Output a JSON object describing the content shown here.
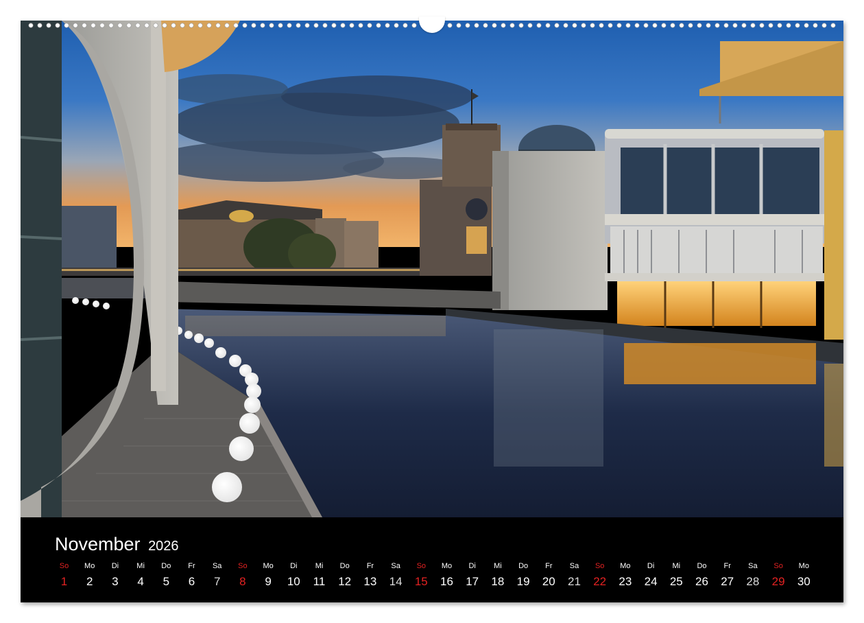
{
  "calendar": {
    "month": "November",
    "year": "2026",
    "days": [
      {
        "abbr": "So",
        "num": "1",
        "sunday": true
      },
      {
        "abbr": "Mo",
        "num": "2"
      },
      {
        "abbr": "Di",
        "num": "3"
      },
      {
        "abbr": "Mi",
        "num": "4"
      },
      {
        "abbr": "Do",
        "num": "5"
      },
      {
        "abbr": "Fr",
        "num": "6"
      },
      {
        "abbr": "Sa",
        "num": "7",
        "saturday": true
      },
      {
        "abbr": "So",
        "num": "8",
        "sunday": true
      },
      {
        "abbr": "Mo",
        "num": "9"
      },
      {
        "abbr": "Di",
        "num": "10"
      },
      {
        "abbr": "Mi",
        "num": "11"
      },
      {
        "abbr": "Do",
        "num": "12"
      },
      {
        "abbr": "Fr",
        "num": "13"
      },
      {
        "abbr": "Sa",
        "num": "14",
        "saturday": true
      },
      {
        "abbr": "So",
        "num": "15",
        "sunday": true
      },
      {
        "abbr": "Mo",
        "num": "16"
      },
      {
        "abbr": "Di",
        "num": "17"
      },
      {
        "abbr": "Mi",
        "num": "18"
      },
      {
        "abbr": "Do",
        "num": "19"
      },
      {
        "abbr": "Fr",
        "num": "20"
      },
      {
        "abbr": "Sa",
        "num": "21",
        "saturday": true
      },
      {
        "abbr": "So",
        "num": "22",
        "sunday": true
      },
      {
        "abbr": "Mo",
        "num": "23"
      },
      {
        "abbr": "Di",
        "num": "24"
      },
      {
        "abbr": "Mi",
        "num": "25"
      },
      {
        "abbr": "Do",
        "num": "26"
      },
      {
        "abbr": "Fr",
        "num": "27"
      },
      {
        "abbr": "Sa",
        "num": "28",
        "saturday": true
      },
      {
        "abbr": "So",
        "num": "29",
        "sunday": true
      },
      {
        "abbr": "Mo",
        "num": "30"
      }
    ]
  },
  "colors": {
    "sunday": "#e32222",
    "weekday": "#ffffff",
    "bar_background": "#000000"
  }
}
